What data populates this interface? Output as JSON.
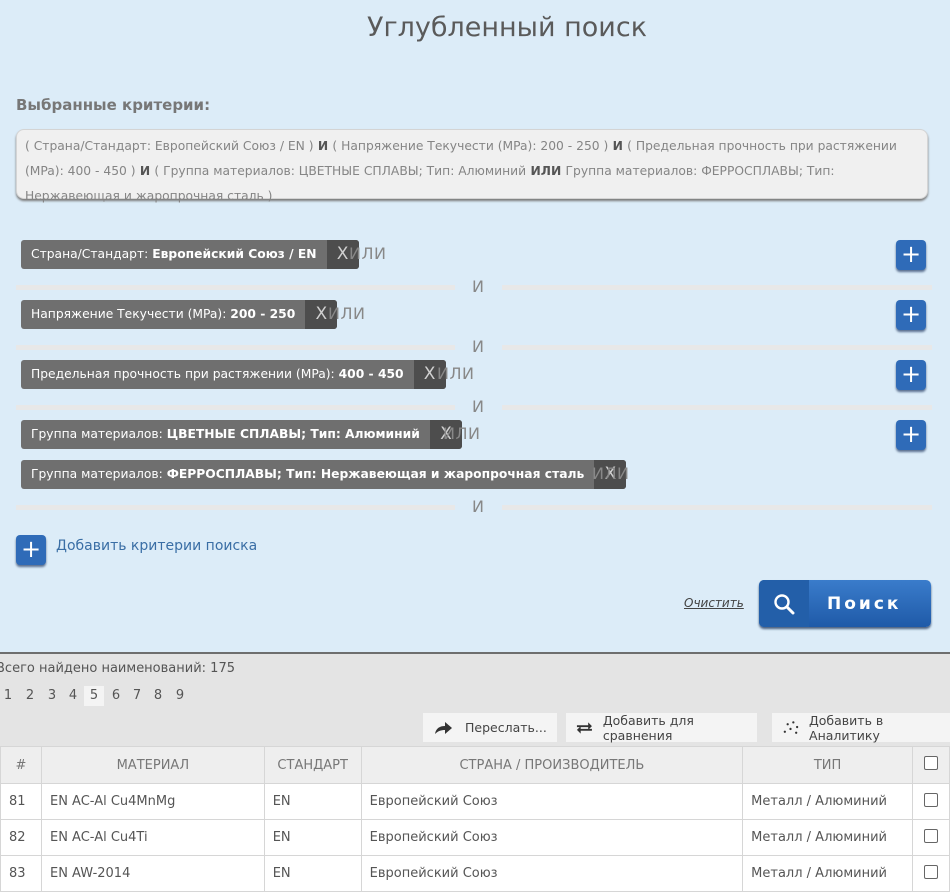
{
  "header": {
    "title": "Углубленный поиск"
  },
  "selected": {
    "label": "Выбранные критерии:",
    "parts": [
      "( Страна/Стандарт: Европейский Союз / EN )",
      " И ",
      "( Напряжение Текучести (MPa): 200 - 250 )",
      " И ",
      "( Предельная прочность при растяжении (MPa): 400 - 450 )",
      " И ",
      "( Группа материалов: ЦВЕТНЫЕ СПЛАВЫ; Тип: Алюминий",
      " ИЛИ ",
      "Группа материалов: ФЕРРОСПЛАВЫ; Тип: Нержавеющая и жаропрочная сталь )"
    ]
  },
  "criteria": {
    "or_label": "ИЛИ",
    "and_label": "И",
    "close_label": "X",
    "plus_label": "+",
    "chips": [
      {
        "key": "Страна/Стандарт:",
        "value": "Европейский Союз / EN"
      },
      {
        "key": "Напряжение Текучести (MPa):",
        "value": "200 - 250"
      },
      {
        "key": "Предельная прочность при растяжении (MPa):",
        "value": "400 - 450"
      },
      {
        "key": "Группа материалов:",
        "value": "ЦВЕТНЫЕ СПЛАВЫ; Тип: Алюминий"
      },
      {
        "key": "Группа материалов:",
        "value": "ФЕРРОСПЛАВЫ; Тип: Нержавеющая и жаропрочная сталь"
      }
    ]
  },
  "actions": {
    "add_criteria": "Добавить критерии поиска",
    "clear": "Очистить",
    "search": "Поиск"
  },
  "results": {
    "total": "Всего найдено наименований: 175",
    "pages": [
      "1",
      "2",
      "3",
      "4",
      "5",
      "6",
      "7",
      "8",
      "9"
    ],
    "current_page": "5",
    "toolbar": {
      "forward": "Переслать...",
      "compare": "Добавить для сравнения",
      "analytics": "Добавить в Аналитику"
    },
    "columns": [
      "#",
      "МАТЕРИАЛ",
      "СТАНДАРТ",
      "СТРАНА / ПРОИЗВОДИТЕЛЬ",
      "ТИП"
    ],
    "rows": [
      {
        "num": "81",
        "material": "EN AC-Al Cu4MnMg",
        "standard": "EN",
        "country": "Европейский Союз",
        "type": "Металл / Алюминий"
      },
      {
        "num": "82",
        "material": "EN AC-Al Cu4Ti",
        "standard": "EN",
        "country": "Европейский Союз",
        "type": "Металл / Алюминий"
      },
      {
        "num": "83",
        "material": "EN AW-2014",
        "standard": "EN",
        "country": "Европейский Союз",
        "type": "Металл / Алюминий"
      }
    ]
  },
  "colors": {
    "accent": "#2f6bb8",
    "panel": "#dcecf8",
    "chip": "#6f6f6f"
  }
}
